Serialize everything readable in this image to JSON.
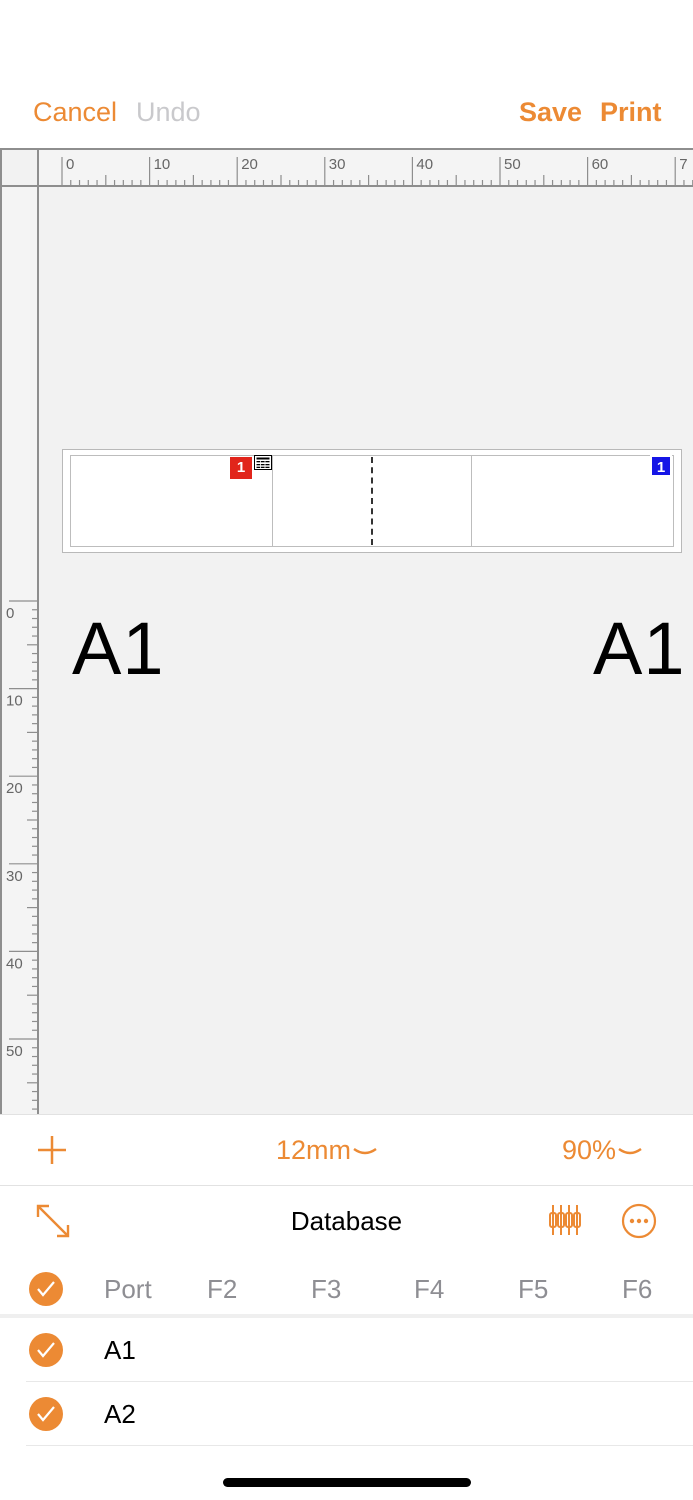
{
  "topbar": {
    "cancel": "Cancel",
    "undo": "Undo",
    "save": "Save",
    "print": "Print"
  },
  "ruler": {
    "horizontal_labels": [
      "0",
      "10",
      "20",
      "30",
      "40",
      "50",
      "60",
      "7"
    ],
    "vertical_labels": [
      "0",
      "10",
      "20",
      "30",
      "40",
      "50"
    ]
  },
  "label": {
    "left_text": "A1",
    "right_text": "A1",
    "left_badge": "1",
    "right_badge": "1",
    "left_badge_color": "#e1251b",
    "right_badge_color": "#1515e6"
  },
  "toolbar": {
    "tape_size": "12mm",
    "zoom": "90%"
  },
  "database": {
    "title": "Database",
    "columns": [
      "Port",
      "F2",
      "F3",
      "F4",
      "F5",
      "F6"
    ],
    "rows": [
      {
        "port": "A1"
      },
      {
        "port": "A2"
      }
    ]
  },
  "colors": {
    "accent": "#ec8a34",
    "disabled": "#c9c9cc"
  }
}
